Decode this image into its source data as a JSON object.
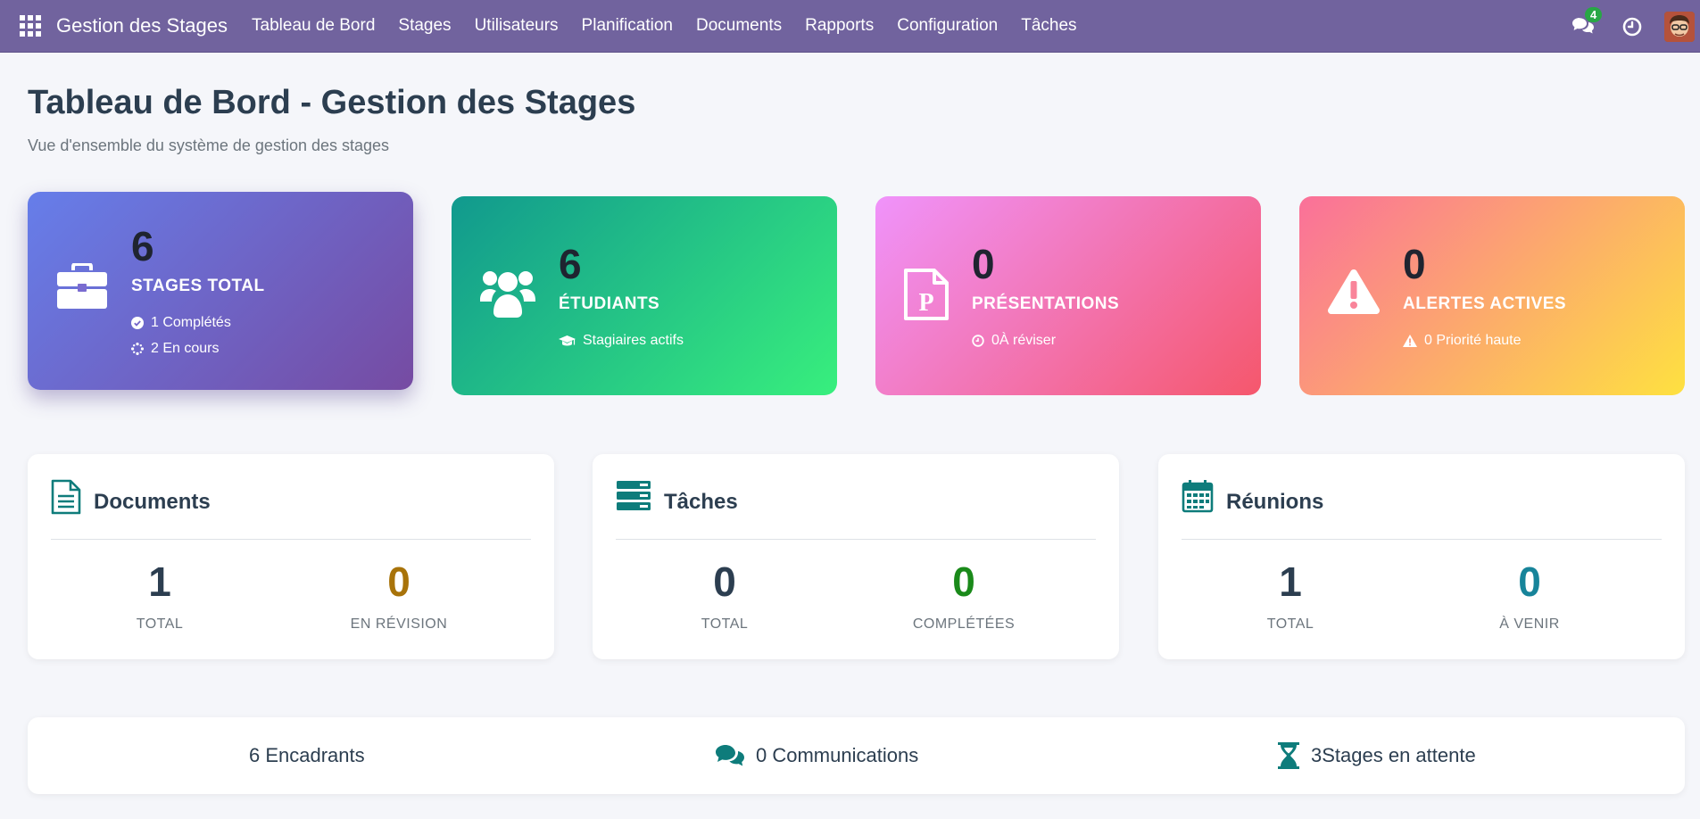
{
  "nav": {
    "brand": "Gestion des Stages",
    "menu": [
      "Tableau de Bord",
      "Stages",
      "Utilisateurs",
      "Planification",
      "Documents",
      "Rapports",
      "Configuration",
      "Tâches"
    ],
    "messages_badge": "4"
  },
  "header": {
    "title": "Tableau de Bord - Gestion des Stages",
    "subtitle": "Vue d'ensemble du système de gestion des stages"
  },
  "kpis": [
    {
      "value": "6",
      "label": "STAGES TOTAL",
      "sub1": "1 Complétés",
      "sub2": "2 En cours",
      "icon": "briefcase-icon"
    },
    {
      "value": "6",
      "label": "ÉTUDIANTS",
      "sub1": "Stagiaires actifs",
      "icon": "users-icon"
    },
    {
      "value": "0",
      "label": "PRÉSENTATIONS",
      "sub1": "0À réviser",
      "icon": "presentation-file-icon"
    },
    {
      "value": "0",
      "label": "ALERTES ACTIVES",
      "sub1": "0 Priorité haute",
      "icon": "warning-icon"
    }
  ],
  "sections": [
    {
      "title": "Documents",
      "icon": "document-icon",
      "stats": [
        {
          "value": "1",
          "label": "TOTAL",
          "color": "#2c3e50"
        },
        {
          "value": "0",
          "label": "EN RÉVISION",
          "color": "#a8730a"
        }
      ]
    },
    {
      "title": "Tâches",
      "icon": "tasks-icon",
      "stats": [
        {
          "value": "0",
          "label": "TOTAL",
          "color": "#2c3e50"
        },
        {
          "value": "0",
          "label": "COMPLÉTÉES",
          "color": "#1a8a1a"
        }
      ]
    },
    {
      "title": "Réunions",
      "icon": "calendar-icon",
      "stats": [
        {
          "value": "1",
          "label": "TOTAL",
          "color": "#2c3e50"
        },
        {
          "value": "0",
          "label": "À VENIR",
          "color": "#17849a"
        }
      ]
    }
  ],
  "footer": {
    "encadrants": "6 Encadrants",
    "communications": "0 Communications",
    "attente": "3Stages en attente"
  },
  "colors": {
    "navbar": "#71639e",
    "teal_icon": "#0e7c7b"
  }
}
